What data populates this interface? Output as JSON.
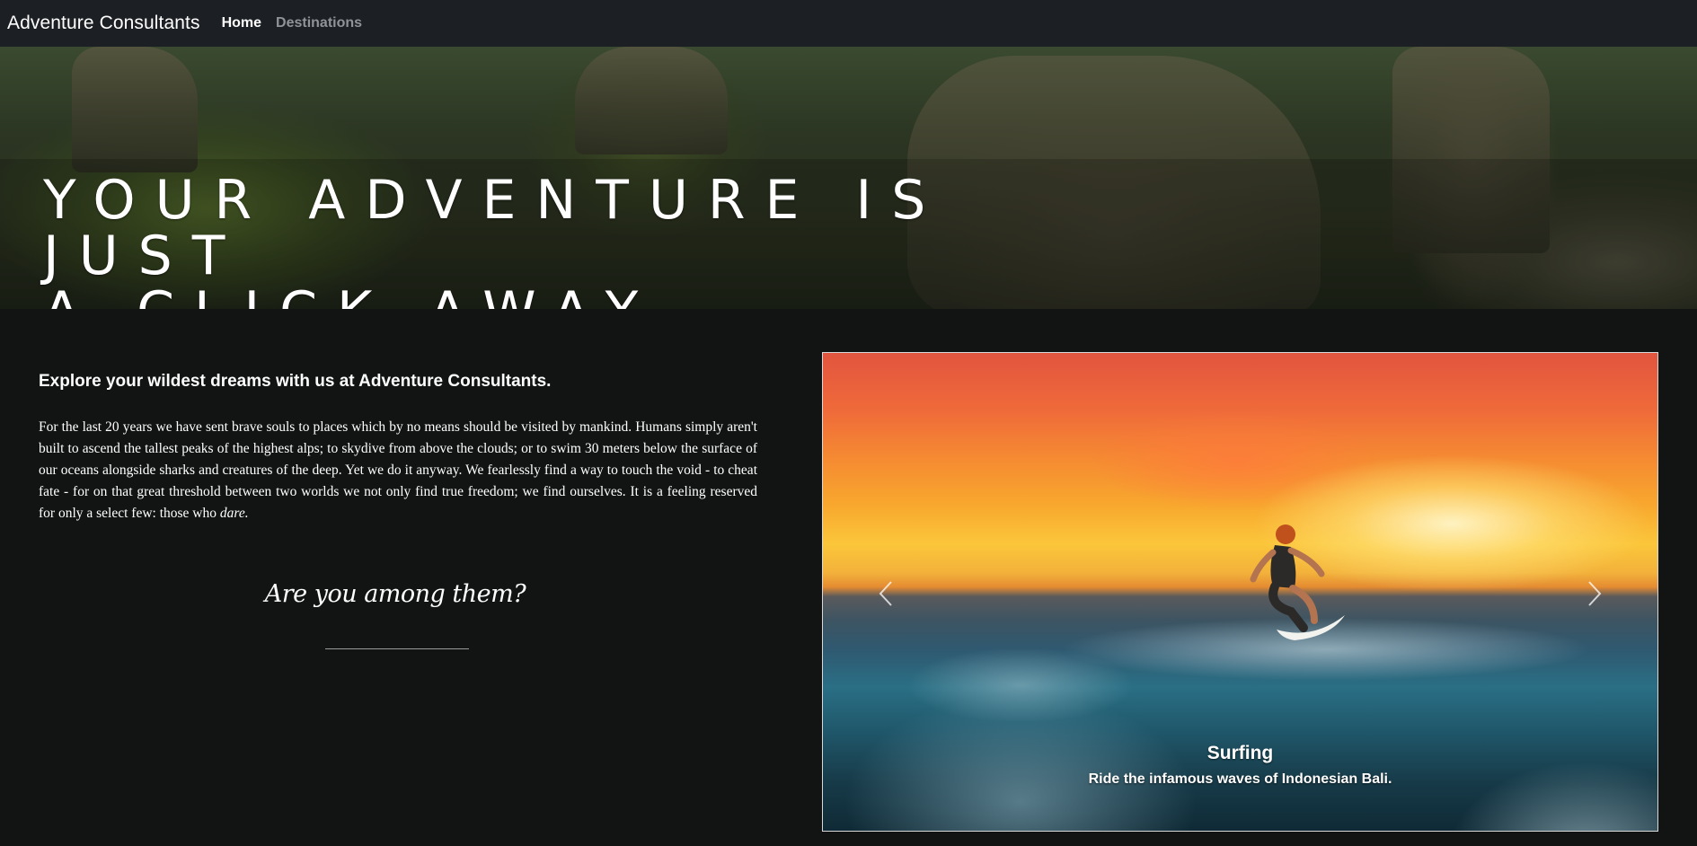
{
  "navbar": {
    "brand": "Adventure Consultants",
    "links": [
      {
        "label": "Home",
        "active": true
      },
      {
        "label": "Destinations",
        "active": false
      }
    ]
  },
  "hero": {
    "title_line1": "YOUR ADVENTURE IS JUST",
    "title_line2": "A CLICK AWAY."
  },
  "intro": {
    "heading": "Explore your wildest dreams with us at Adventure Consultants.",
    "paragraph": "For the last 20 years we have sent brave souls to places which by no means should be visited by mankind. Humans simply aren't built to ascend the tallest peaks of the highest alps; to skydive from above the clouds; or to swim 30 meters below the surface of our oceans alongside sharks and creatures of the deep. Yet we do it anyway. We fearlessly find a way to touch the void - to cheat fate - for on that great threshold between two worlds we not only find true freedom; we find ourselves. It is a feeling reserved for only a select few: those who",
    "emphasis": "dare.",
    "tagline": "Are you among them?"
  },
  "carousel": {
    "slide_title": "Surfing",
    "slide_text": "Ride the infamous waves of Indonesian Bali.",
    "prev_icon": "chevron-left-icon",
    "next_icon": "chevron-right-icon"
  },
  "colors": {
    "navbar_bg": "#1c1f23",
    "page_bg": "#121414",
    "nav_muted": "#8f9499"
  }
}
